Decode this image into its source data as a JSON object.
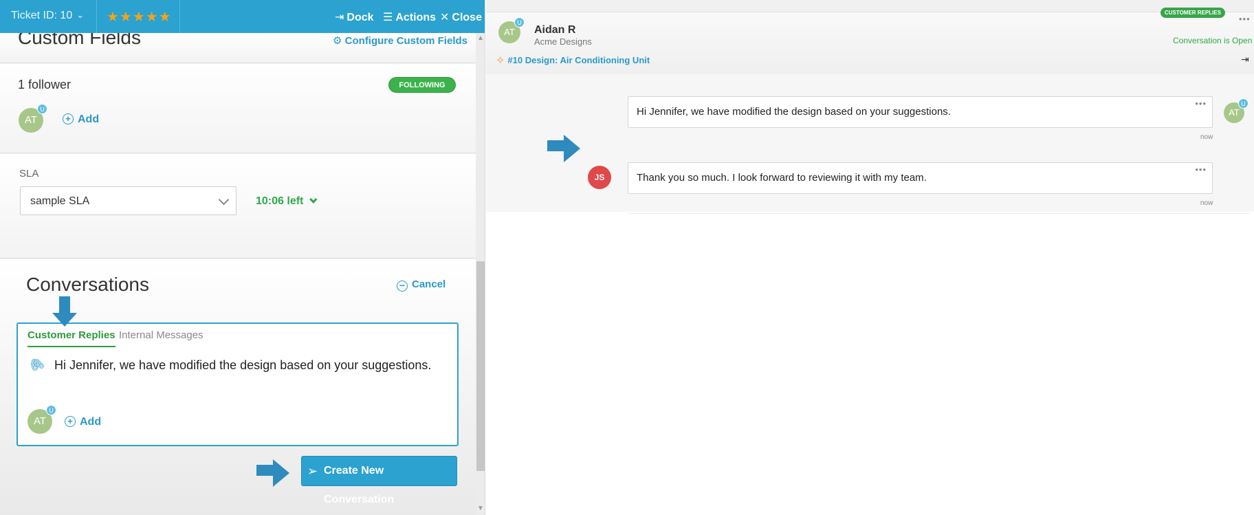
{
  "left_panel": {
    "topbar": {
      "ticket_id": "Ticket ID: 10",
      "stars": "★★★★★",
      "dock": "Dock",
      "actions": "Actions",
      "close": "Close"
    },
    "custom_fields": {
      "title": "Custom Fields",
      "configure": "Configure Custom Fields"
    },
    "followers": {
      "count_text": "1 follower",
      "status_badge": "FOLLOWING",
      "avatar_initials": "AT",
      "avatar_badge": "U",
      "add_label": "Add"
    },
    "sla": {
      "label": "SLA",
      "selected": "sample SLA",
      "time_left": "10:06 left"
    },
    "conversations": {
      "title": "Conversations",
      "cancel": "Cancel",
      "tabs": [
        "Customer Replies",
        "Internal Messages"
      ],
      "message": "Hi Jennifer, we have modified the design based on your suggestions.",
      "avatar_initials": "AT",
      "avatar_badge": "U",
      "add_label": "Add",
      "create_button": "Create New Conversation"
    }
  },
  "right_panel": {
    "header": {
      "avatar_initials": "AT",
      "avatar_badge": "U",
      "contact_name": "Aidan R",
      "company": "Acme Designs",
      "channel_badge": "CUSTOMER REPLIES",
      "status": "Conversation is Open",
      "ticket_link": "#10 Design: Air Conditioning Unit"
    },
    "messages": [
      {
        "text": "Hi Jennifer, we have modified the design based on your suggestions.",
        "time": "now",
        "author_initials": "AT",
        "author_badge": "U"
      },
      {
        "text": "Thank you so much. I look forward to reviewing it with my team.",
        "time": "now",
        "author_initials": "JS"
      }
    ]
  },
  "colors": {
    "primary": "#2ba2cf",
    "success": "#3bb34a",
    "star": "#f6a218",
    "arrow": "#2e8bbd",
    "avatar_at": "#a7c78a",
    "avatar_js": "#e0484a"
  },
  "icons": [
    "chevron-down-icon",
    "star-icon",
    "dock-icon",
    "menu-icon",
    "close-icon",
    "gear-icon",
    "plus-circle-icon",
    "minus-circle-icon",
    "paperclip-icon",
    "send-icon",
    "ticket-icon",
    "exit-icon",
    "more-icon",
    "arrow-icon"
  ]
}
